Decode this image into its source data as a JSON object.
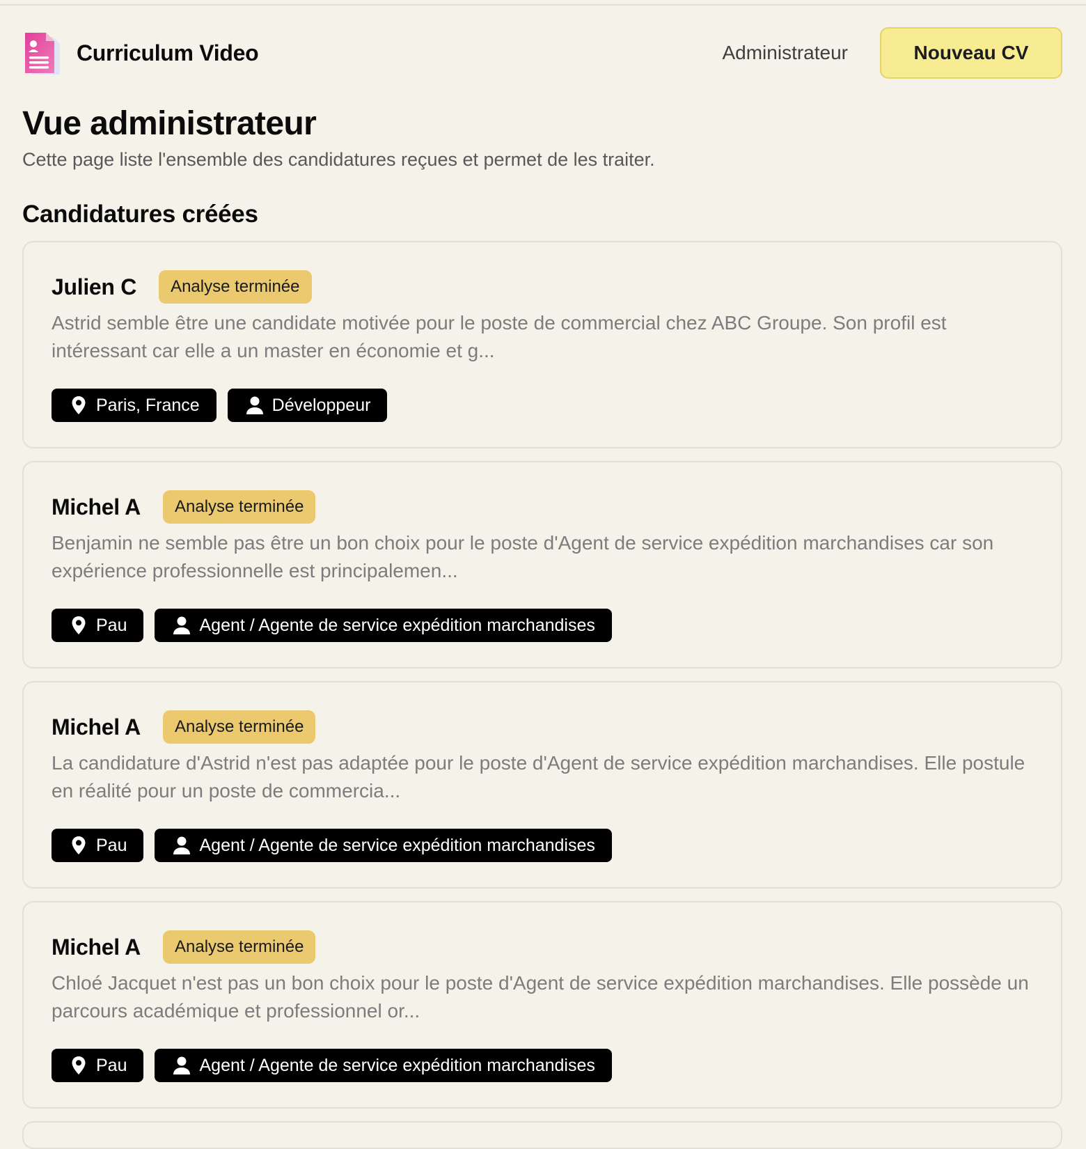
{
  "app": {
    "name": "Curriculum Video",
    "logo_icon": "document-user-icon",
    "accent_color": "#f8ec92",
    "badge_color": "#ebc96f"
  },
  "nav": {
    "admin_label": "Administrateur",
    "new_cv_label": "Nouveau CV"
  },
  "page": {
    "title": "Vue administrateur",
    "subtitle": "Cette page liste l'ensemble des candidatures reçues et permet de les traiter.",
    "section_title": "Candidatures créées"
  },
  "candidates": [
    {
      "name": "Julien C",
      "status": "Analyse terminée",
      "summary": "Astrid semble être une candidate motivée pour le poste de commercial chez ABC Groupe. Son profil est intéressant car elle a un master en économie et g...",
      "location": "Paris, France",
      "role": "Développeur"
    },
    {
      "name": "Michel A",
      "status": "Analyse terminée",
      "summary": "Benjamin ne semble pas être un bon choix pour le poste d'Agent de service expédition marchandises car son expérience professionnelle est principalemen...",
      "location": "Pau",
      "role": "Agent / Agente de service expédition marchandises"
    },
    {
      "name": "Michel A",
      "status": "Analyse terminée",
      "summary": "La candidature d'Astrid n'est pas adaptée pour le poste d'Agent de service expédition marchandises. Elle postule en réalité pour un poste de commercia...",
      "location": "Pau",
      "role": "Agent / Agente de service expédition marchandises"
    },
    {
      "name": "Michel A",
      "status": "Analyse terminée",
      "summary": "Chloé Jacquet n'est pas un bon choix pour le poste d'Agent de service expédition marchandises. Elle possède un parcours académique et professionnel or...",
      "location": "Pau",
      "role": "Agent / Agente de service expédition marchandises"
    }
  ],
  "icons": {
    "location": "map-pin-icon",
    "role": "person-icon"
  }
}
